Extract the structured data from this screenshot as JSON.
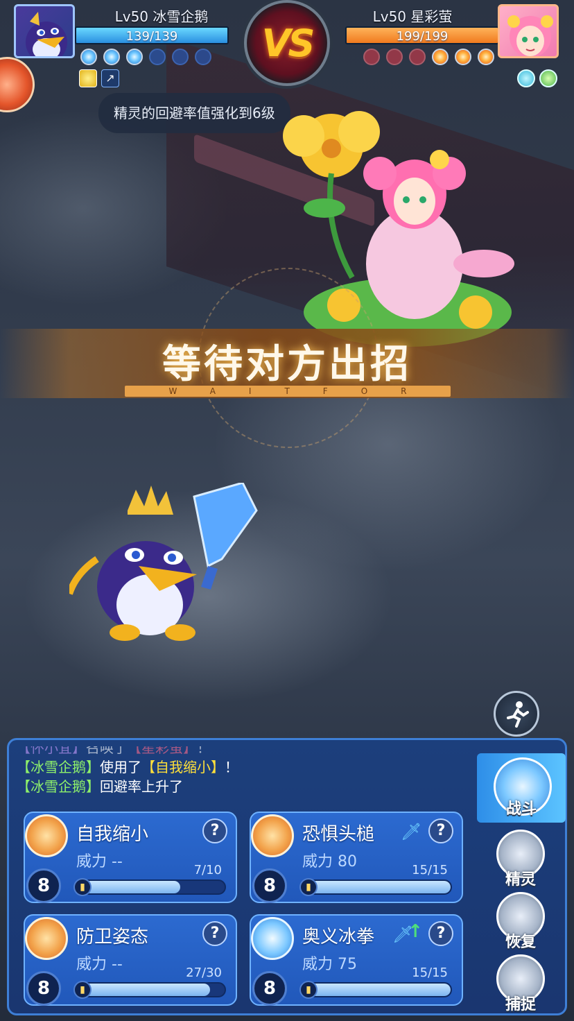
{
  "player": {
    "level_name": "Lv50 冰雪企鹅",
    "hp_text": "139/139",
    "hp_fraction": 1.0,
    "pips": [
      "on",
      "on",
      "on",
      "off",
      "off",
      "off"
    ],
    "status_icons": [
      "buff-yellow",
      "evasion-up-icon"
    ]
  },
  "enemy": {
    "level_name": "Lv50 星彩萤",
    "hp_text": "199/199",
    "hp_fraction": 1.0,
    "pips": [
      "off",
      "off",
      "off",
      "on",
      "on",
      "on"
    ],
    "status_icons": [
      "water-element-icon",
      "leaf-element-icon"
    ]
  },
  "vs_label": "VS",
  "tooltip": "精灵的回避率值强化到6级",
  "banner": {
    "title": "等待对方出招",
    "subtitle": "WAITFOR"
  },
  "battle_log": [
    {
      "parts": [
        {
          "t": "【",
          "c": "p"
        },
        {
          "t": "怀小宜",
          "c": "p"
        },
        {
          "t": "】",
          "c": "p"
        },
        {
          "t": "召唤了",
          "c": ""
        },
        {
          "t": "【星彩萤】",
          "c": "r"
        },
        {
          "t": "！",
          "c": ""
        }
      ],
      "faded": true
    },
    {
      "parts": [
        {
          "t": "【冰雪企鹅】",
          "c": "g"
        },
        {
          "t": "使用了",
          "c": ""
        },
        {
          "t": "【自我缩小】",
          "c": "y"
        },
        {
          "t": "！",
          "c": ""
        }
      ],
      "faded": false
    },
    {
      "parts": [
        {
          "t": "【冰雪企鹅】",
          "c": "g"
        },
        {
          "t": "回避率上升了",
          "c": ""
        }
      ],
      "faded": false
    }
  ],
  "skills": [
    {
      "name": "自我缩小",
      "power": "威力 --",
      "pp": "7/10",
      "pp_fraction": 0.7,
      "cost": "8",
      "icon": "shrink-skill-icon",
      "has_type_icon": false,
      "boosted": false
    },
    {
      "name": "恐惧头槌",
      "power": "威力 80",
      "pp": "15/15",
      "pp_fraction": 1.0,
      "cost": "8",
      "icon": "headbutt-skill-icon",
      "has_type_icon": true,
      "boosted": false
    },
    {
      "name": "防卫姿态",
      "power": "威力 --",
      "pp": "27/30",
      "pp_fraction": 0.9,
      "cost": "8",
      "icon": "defense-skill-icon",
      "has_type_icon": false,
      "boosted": false
    },
    {
      "name": "奥义冰拳",
      "power": "威力 75",
      "pp": "15/15",
      "pp_fraction": 1.0,
      "cost": "8",
      "icon": "ice-fist-skill-icon",
      "has_type_icon": true,
      "boosted": true
    }
  ],
  "help_label": "?",
  "menu": {
    "battle": "战斗",
    "pets": "精灵",
    "heal": "恢复",
    "catch": "捕捉"
  },
  "colors": {
    "player_hp": "#2a8fe0",
    "enemy_hp": "#f07a1e",
    "panel": "#1c3f7c",
    "skill_card": "#2c6ad0",
    "banner": "#82481a"
  }
}
